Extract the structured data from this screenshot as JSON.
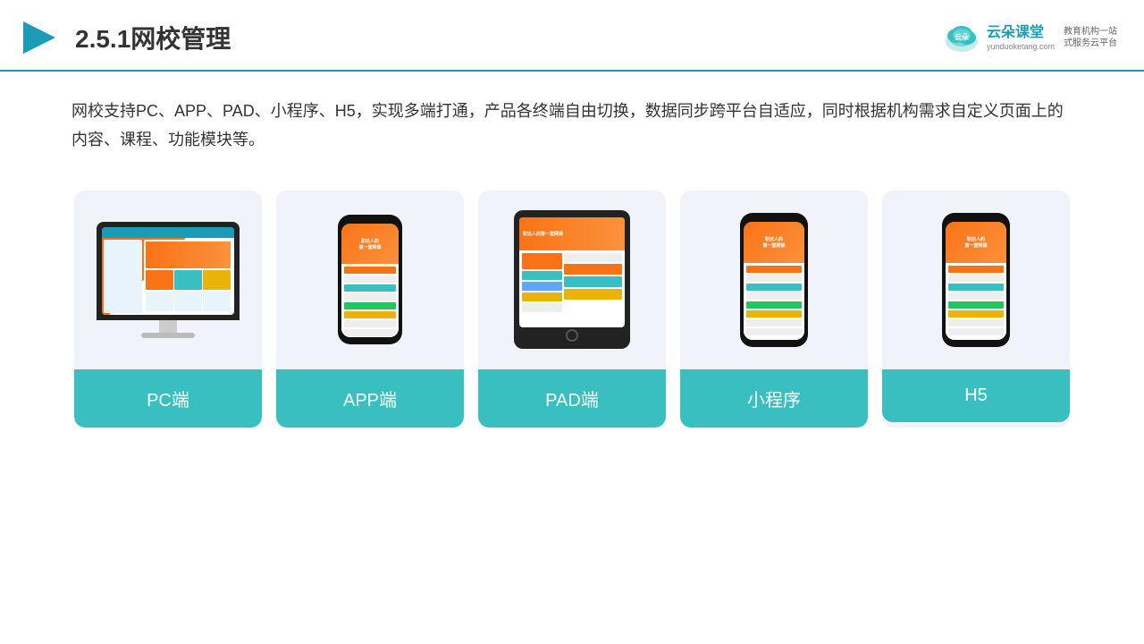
{
  "header": {
    "title": "2.5.1网校管理",
    "brand": {
      "name": "云朵课堂",
      "url": "yunduoketang.com",
      "slogan": "教育机构一站\n式服务云平台"
    }
  },
  "description": "网校支持PC、APP、PAD、小程序、H5，实现多端打通，产品各终端自由切换，数据同步跨平台自适应，同时根据机构需求自定义页面上的内容、课程、功能模块等。",
  "cards": [
    {
      "id": "pc",
      "label": "PC端",
      "type": "pc"
    },
    {
      "id": "app",
      "label": "APP端",
      "type": "phone"
    },
    {
      "id": "pad",
      "label": "PAD端",
      "type": "tablet"
    },
    {
      "id": "miniapp",
      "label": "小程序",
      "type": "phone"
    },
    {
      "id": "h5",
      "label": "H5",
      "type": "phone"
    }
  ]
}
